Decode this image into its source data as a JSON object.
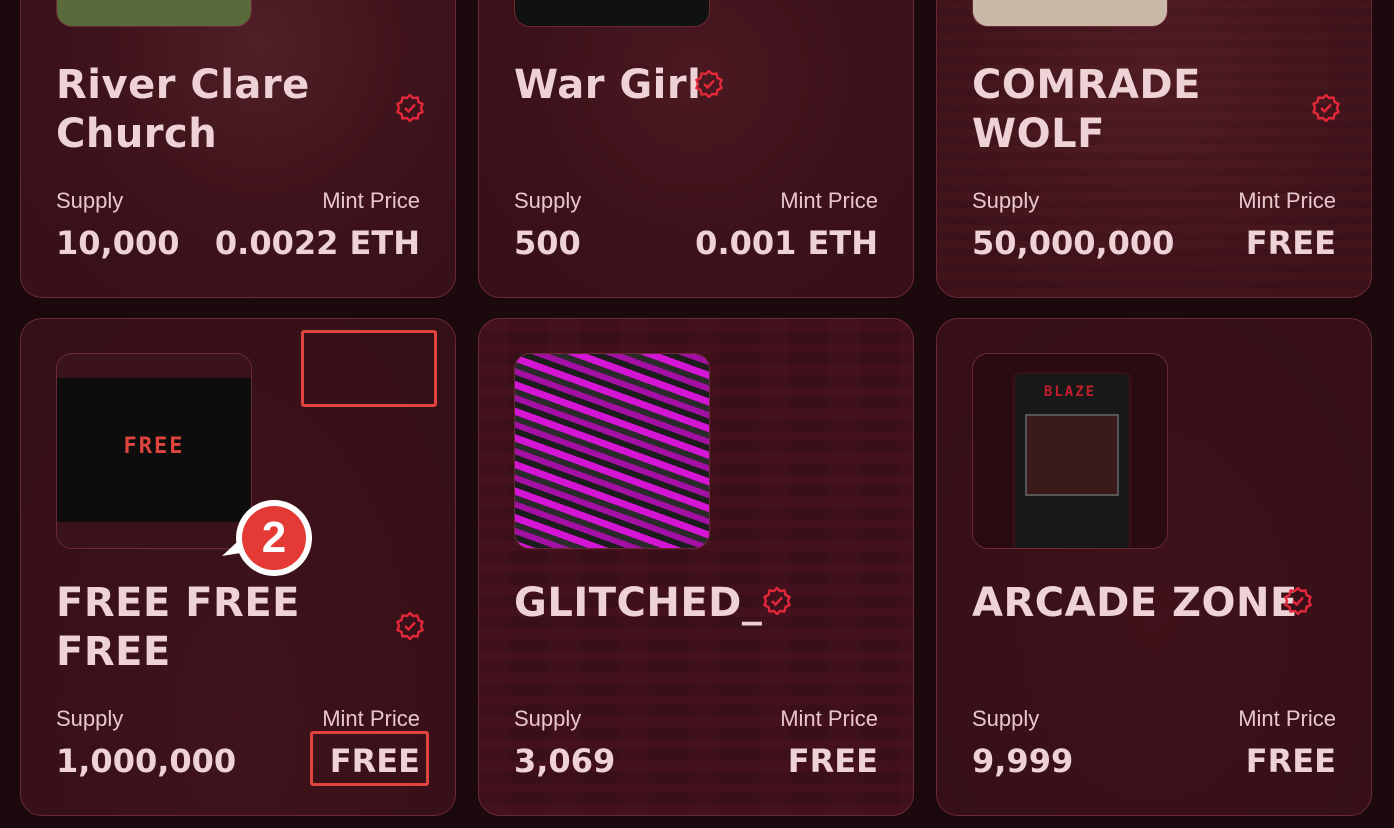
{
  "labels": {
    "supply": "Supply",
    "mint_price": "Mint Price"
  },
  "cards": [
    {
      "title": "River Clare Church",
      "supply": "10,000",
      "price": "0.0022 ETH"
    },
    {
      "title": "War Girl",
      "supply": "500",
      "price": "0.001 ETH"
    },
    {
      "title": "COMRADE WOLF",
      "supply": "50,000,000",
      "price": "FREE"
    },
    {
      "title": "FREE FREE FREE",
      "supply": "1,000,000",
      "price": "FREE",
      "thumb_text": "FREE"
    },
    {
      "title": "GLITCHED_",
      "supply": "3,069",
      "price": "FREE"
    },
    {
      "title": "ARCADE ZONE",
      "supply": "9,999",
      "price": "FREE",
      "thumb_text": "BLAZE"
    }
  ],
  "annotation": {
    "step": "2"
  },
  "colors": {
    "accent": "#e0443e",
    "verified": "#e2283a",
    "text": "#efd2d6"
  }
}
